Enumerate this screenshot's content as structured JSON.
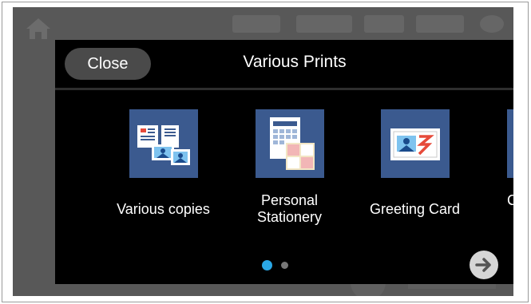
{
  "dialog": {
    "close_label": "Close",
    "title": "Various Prints"
  },
  "items": [
    {
      "label": "Various copies",
      "icon": "various-copies-icon"
    },
    {
      "label": "Personal Stationery",
      "icon": "personal-stationery-icon"
    },
    {
      "label": "Greeting Card",
      "icon": "greeting-card-icon"
    },
    {
      "label": "Copy DVD",
      "icon": "copy-dvd-icon"
    }
  ],
  "pagination": {
    "current_page": 1,
    "total_pages": 2
  },
  "colors": {
    "tile": "#3b5a8f",
    "dot_active": "#2aa7e6",
    "dialog_bg": "#000000",
    "close_button": "#4a4a4a"
  },
  "icons": {
    "next": "arrow-right-circle-icon",
    "home": "home-icon"
  }
}
